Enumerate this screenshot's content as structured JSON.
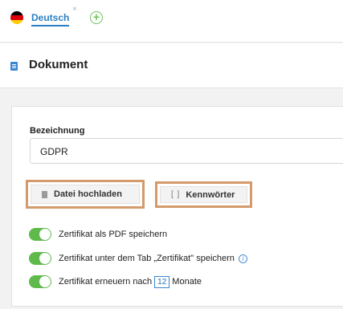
{
  "language_bar": {
    "active_language": "Deutsch",
    "close_symbol": "×",
    "add_symbol": "+",
    "flag_colors": [
      "#000000",
      "#dd0000",
      "#ffce00"
    ]
  },
  "header": {
    "icon": "document-icon",
    "title": "Dokument"
  },
  "form": {
    "name_label": "Bezeichnung",
    "name_value": "GDPR",
    "upload_button": "Datei hochladen",
    "passwords_button": "Kennwörter",
    "toggles": [
      {
        "label": "Zertifikat als PDF speichern",
        "on": true
      },
      {
        "label": "Zertifikat unter dem Tab „Zertifikat\" speichern",
        "on": true,
        "info_icon": "i"
      },
      {
        "label_before": "Zertifikat erneuern nach",
        "value": "12",
        "label_after": "Monate",
        "on": true
      }
    ]
  },
  "colors": {
    "accent": "#2a7fc4",
    "toggle_on": "#5fb94b",
    "highlight_frame": "#d49a6a"
  }
}
